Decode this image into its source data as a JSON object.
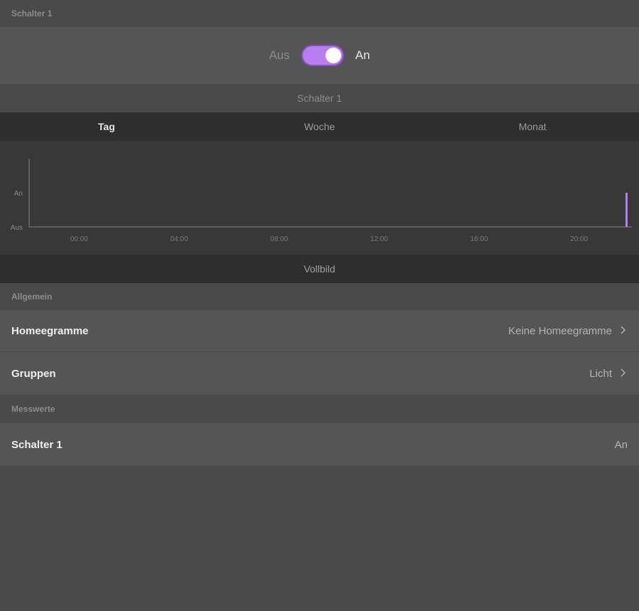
{
  "accessory": {
    "section_title": "Schalter 1",
    "toggle_off_label": "Aus",
    "toggle_on_label": "An",
    "toggle_state": "on"
  },
  "history": {
    "title": "Schalter 1",
    "tabs": [
      {
        "label": "Tag",
        "active": true
      },
      {
        "label": "Woche",
        "active": false
      },
      {
        "label": "Monat",
        "active": false
      }
    ],
    "fullscreen_label": "Vollbild"
  },
  "chart_data": {
    "type": "line",
    "title": "Schalter 1",
    "y_categories": [
      "Aus",
      "An"
    ],
    "x_ticks": [
      "00:00",
      "04:00",
      "08:00",
      "12:00",
      "16:00",
      "20:00"
    ],
    "xlim": [
      -2,
      22
    ],
    "series": [
      {
        "values": [
          {
            "x": 21.9,
            "y": "Aus"
          },
          {
            "x": 21.9,
            "y": "An"
          }
        ],
        "color": "#b97df0"
      }
    ]
  },
  "general": {
    "section_title": "Allgemein",
    "rows": [
      {
        "label": "Homeegramme",
        "value": "Keine Homeegramme",
        "chevron": "chevron-right-icon"
      },
      {
        "label": "Gruppen",
        "value": "Licht",
        "chevron": "chevron-right-icon"
      }
    ]
  },
  "measurements": {
    "section_title": "Messwerte",
    "rows": [
      {
        "label": "Schalter 1",
        "value": "An"
      }
    ]
  },
  "colors": {
    "accent": "#b97df0",
    "background": "#4a4a4a",
    "row": "#555555",
    "dark_bar": "#2e2e2e",
    "chart_bg": "#383838"
  }
}
